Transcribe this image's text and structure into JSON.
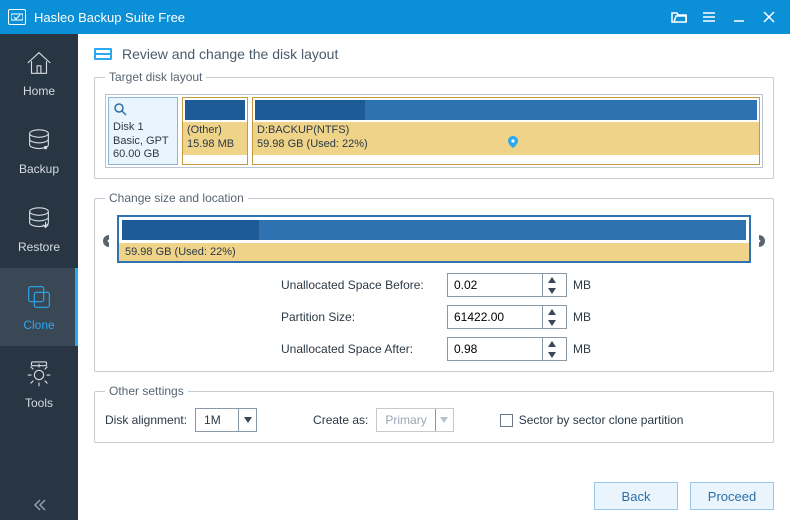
{
  "app": {
    "title": "Hasleo Backup Suite Free"
  },
  "sidebar": {
    "items": [
      {
        "label": "Home"
      },
      {
        "label": "Backup"
      },
      {
        "label": "Restore"
      },
      {
        "label": "Clone"
      },
      {
        "label": "Tools"
      }
    ]
  },
  "page": {
    "title": "Review and change the disk layout"
  },
  "groups": {
    "target": "Target disk layout",
    "change": "Change size and location",
    "other": "Other settings"
  },
  "disk": {
    "name": "Disk 1",
    "type": "Basic, GPT",
    "size": "60.00 GB"
  },
  "partitions": {
    "other": {
      "label": "(Other)",
      "size": "15.98 MB"
    },
    "backup": {
      "label": "D:BACKUP(NTFS)",
      "size_used": "59.98 GB (Used: 22%)",
      "used_pct": 22
    }
  },
  "resize": {
    "size_used": "59.98 GB (Used: 22%)",
    "used_pct": 22,
    "fields": {
      "before": {
        "label": "Unallocated Space Before:",
        "value": "0.02",
        "unit": "MB"
      },
      "size": {
        "label": "Partition Size:",
        "value": "61422.00",
        "unit": "MB"
      },
      "after": {
        "label": "Unallocated Space After:",
        "value": "0.98",
        "unit": "MB"
      }
    }
  },
  "other": {
    "alignment_label": "Disk alignment:",
    "alignment_value": "1M",
    "create_as_label": "Create as:",
    "create_as_value": "Primary",
    "sector_label": "Sector by sector clone partition",
    "sector_checked": false
  },
  "footer": {
    "back": "Back",
    "proceed": "Proceed"
  }
}
